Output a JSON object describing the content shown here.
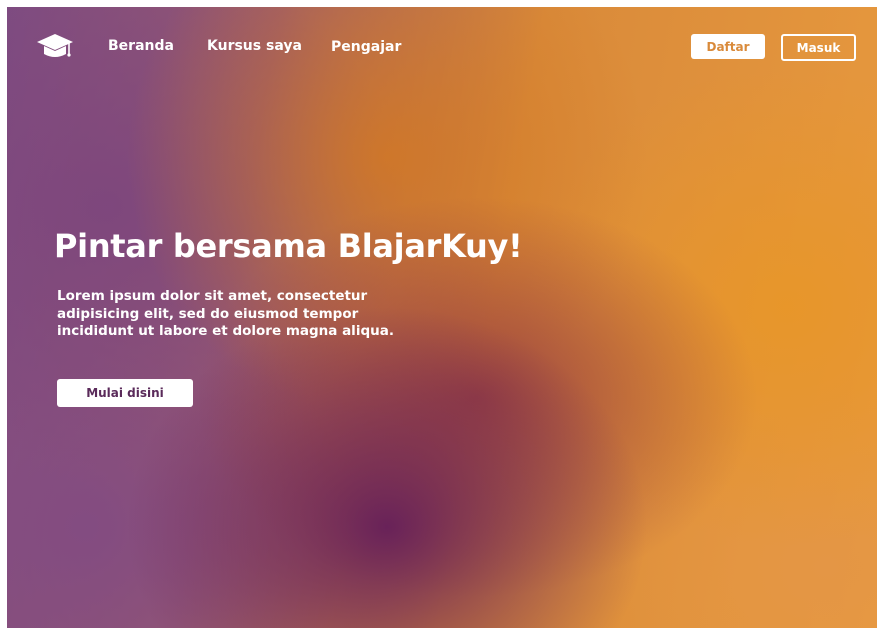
{
  "nav": {
    "logo_icon": "graduation-cap-icon",
    "links": [
      {
        "label": "Beranda"
      },
      {
        "label": "Kursus saya"
      },
      {
        "label": "Pengajar"
      }
    ],
    "register_label": "Daftar",
    "login_label": "Masuk"
  },
  "hero": {
    "title": "Pintar bersama BlajarKuy!",
    "description": "Lorem ipsum dolor sit amet, consectetur adipisicing elit, sed do eiusmod tempor incididunt ut labore et dolore magna aliqua.",
    "cta_label": "Mulai disini"
  },
  "colors": {
    "accent_orange": "#e89a3e",
    "accent_purple": "#7e4c82",
    "text_light": "#ffffff"
  }
}
